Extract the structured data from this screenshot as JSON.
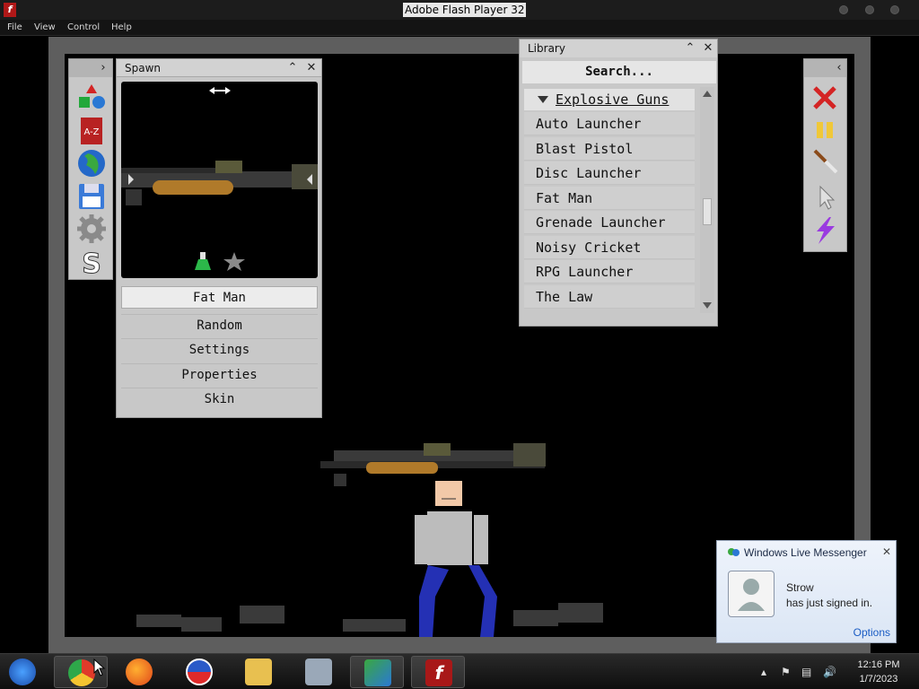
{
  "window": {
    "title": "Adobe Flash Player 32"
  },
  "menu": [
    "File",
    "View",
    "Control",
    "Help"
  ],
  "spawn_panel": {
    "title": "Spawn",
    "buttons": [
      "Fat Man",
      "Random",
      "Settings",
      "Properties",
      "Skin"
    ],
    "selected": "Fat Man"
  },
  "library_panel": {
    "title": "Library",
    "search": "Search...",
    "category": "Explosive Guns",
    "items": [
      "Auto Launcher",
      "Blast Pistol",
      "Disc Launcher",
      "Fat Man",
      "Grenade Launcher",
      "Noisy Cricket",
      "RPG Launcher",
      "The Law"
    ]
  },
  "left_tools": [
    "shapes-icon",
    "az-book-icon",
    "globe-icon",
    "floppy-save-icon",
    "gear-icon",
    "s-logo-icon"
  ],
  "right_tools": [
    "delete-x-icon",
    "pause-icon",
    "knife-icon",
    "cursor-icon",
    "lightning-icon"
  ],
  "toast": {
    "app": "Windows Live Messenger",
    "name": "Strow",
    "message": "has just signed in.",
    "options": "Options"
  },
  "taskbar": {
    "apps": [
      "start-orb-icon",
      "chrome-icon",
      "firefox-icon",
      "obama-logo-icon",
      "file-explorer-icon",
      "installer-icon",
      "messenger-icon",
      "flash-player-icon"
    ],
    "time": "12:16 PM",
    "date": "1/7/2023"
  },
  "colors": {
    "panel": "#c8c8c8",
    "stage_border": "#5e5e5e",
    "toast_link": "#1a5cc4"
  }
}
